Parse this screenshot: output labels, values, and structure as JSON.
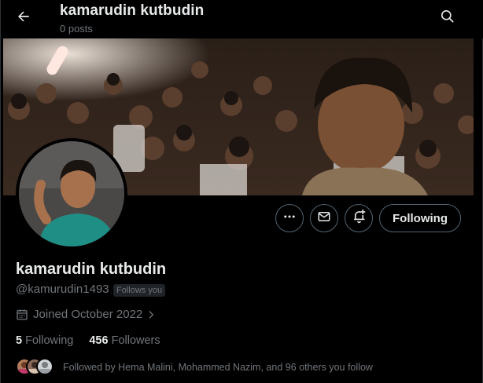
{
  "header": {
    "title": "kamarudin kutbudin",
    "posts_count": "0 posts"
  },
  "profile": {
    "display_name": "kamarudin kutbudin",
    "handle": "@kamurudin1493",
    "follows_you_badge": "Follows you",
    "joined": "Joined October 2022",
    "following_count": "5",
    "following_label": "Following",
    "followers_count": "456",
    "followers_label": "Followers",
    "followed_by": "Followed by Hema Malini, Mohammed Nazim, and 96 others you follow"
  },
  "actions": {
    "more_icon": "more-icon",
    "message_icon": "mail-icon",
    "notify_icon": "bell-plus-icon",
    "follow_label": "Following"
  },
  "colors": {
    "background": "#000000",
    "text_primary": "#e7e9ea",
    "text_secondary": "#71767b",
    "border": "#536471"
  }
}
